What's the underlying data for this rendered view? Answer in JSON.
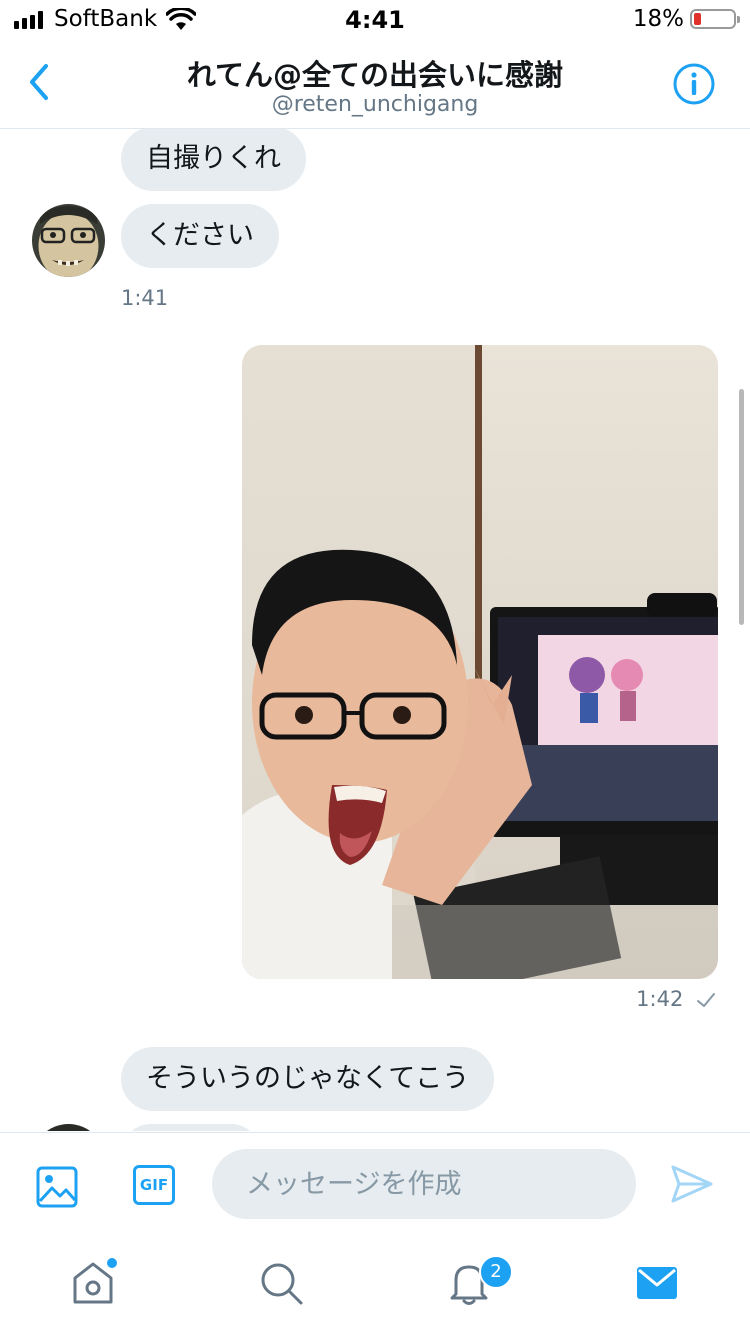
{
  "status_bar": {
    "carrier": "SoftBank",
    "time": "4:41",
    "battery_percent": "18%",
    "battery_level": 0.18
  },
  "header": {
    "title": "れてん@全ての出会いに感謝",
    "handle": "@reten_unchigang",
    "back_icon": "chevron-left-icon",
    "info_icon": "info-circle-icon"
  },
  "messages": {
    "incoming_1": {
      "lines": [
        "自撮りくれ",
        "ください"
      ],
      "time": "1:41"
    },
    "outgoing_1": {
      "time": "1:42",
      "status_icon": "checkmark-icon"
    },
    "incoming_2": {
      "lines": [
        "そういうのじゃなくてこう"
      ]
    }
  },
  "composer": {
    "placeholder": "メッセージを作成",
    "gif_label": "GIF",
    "image_icon": "image-icon",
    "send_icon": "send-icon"
  },
  "tab_bar": {
    "items": [
      "home-icon",
      "search-icon",
      "notifications-icon",
      "messages-icon"
    ],
    "notifications_badge": "2"
  },
  "colors": {
    "accent": "#1da1f2",
    "bubble": "#e6ecf0",
    "secondary_text": "#657786"
  }
}
